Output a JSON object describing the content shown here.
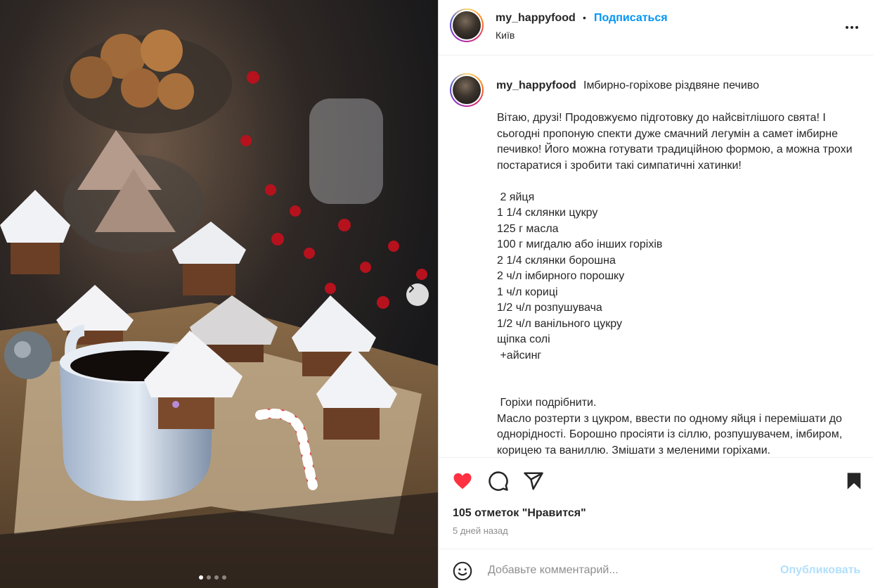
{
  "post": {
    "username": "my_happyfood",
    "separator": "•",
    "follow_label": "Подписаться",
    "location": "Київ",
    "more_icon": "more-horizontal-icon"
  },
  "caption": {
    "username": "my_happyfood",
    "title": "Імбирно-горіхове різдвяне печиво",
    "text": "Вітаю, друзі! Продовжуємо підготовку до найсвітлішого свята! І сьогодні пропоную спекти дуже смачний легумін а самет імбирне печивко! Його можна готувати традиційною формою, а можна трохи постаратися і зробити такі симпатичні хатинки!\n\n 2 яйця\n1 1/4 склянки цукру\n125 г масла\n100 г мигдалю або інших горіхів\n2 1/4 склянки борошна\n2 ч/л імбирного порошку\n1 ч/л кориці\n1/2 ч/л розпушувача\n1/2 ч/л ванільного цукру\nщіпка солі\n +айсинг\n\n\n Горіхи подрібнити.\nМасло розтерти з цукром, ввести по одному яйця і перемішати до однорідності. Борошно просіяти із сіллю, розпушувачем, імбиром, корицею та ваниллю. Змішати з меленими горіхами.\nЗ’єднати сухі інгредієнти з яєчною сумішшю та замісити"
  },
  "actions": {
    "like_icon": "heart-filled-icon",
    "comment_icon": "comment-icon",
    "share_icon": "share-icon",
    "save_icon": "bookmark-filled-icon",
    "like_color": "#ff3040"
  },
  "likes_text": "105 отметок \"Нравится\"",
  "time_text": "5 дней назад",
  "comment_box": {
    "placeholder": "Добавьте комментарий...",
    "publish_label": "Опубликовать"
  },
  "carousel": {
    "current": 1,
    "total": 4,
    "next_icon": "chevron-right-icon"
  },
  "colors": {
    "accent": "#0095f6",
    "publish_disabled": "#b2dffc"
  }
}
